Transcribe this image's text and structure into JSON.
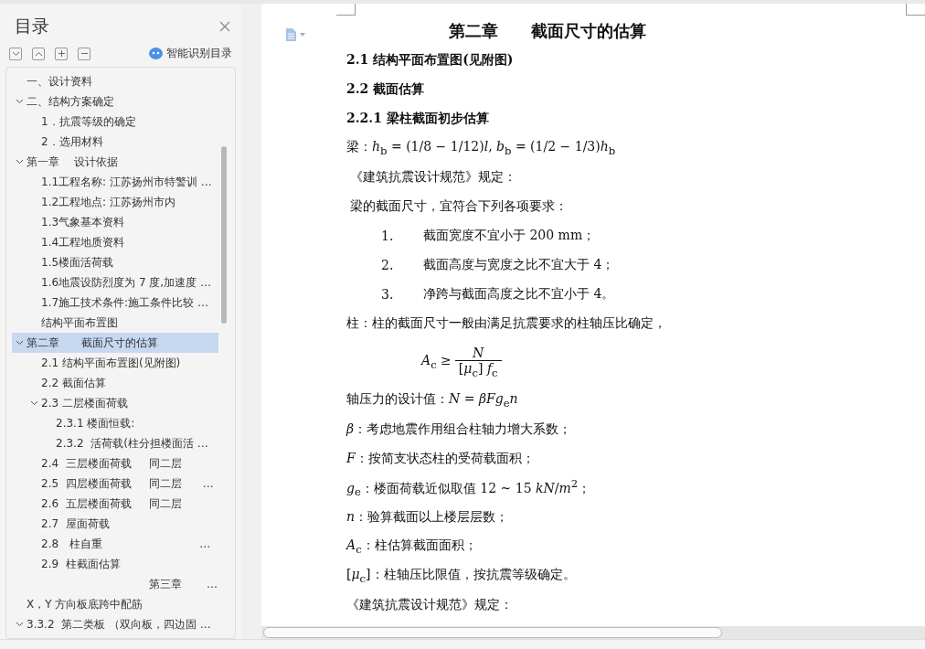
{
  "sidebar": {
    "title": "目录",
    "smart_toc_label": "智能识别目录",
    "outline": [
      {
        "text": "一、设计资料",
        "selected": false
      },
      {
        "text": "二、结构方案确定",
        "selected": false,
        "expanded": true,
        "children": [
          {
            "text": "1．抗震等级的确定",
            "selected": false
          },
          {
            "text": "2．选用材料",
            "selected": false
          }
        ]
      },
      {
        "text": "第一章　 设计依据",
        "selected": false,
        "expanded": true,
        "children": [
          {
            "text": "1.1工程名称: 江苏扬州市特警训 …",
            "selected": false
          },
          {
            "text": "1.2工程地点: 江苏扬州市内",
            "selected": false
          },
          {
            "text": "1.3气象基本资料",
            "selected": false
          },
          {
            "text": "1.4工程地质资料",
            "selected": false
          },
          {
            "text": "1.5楼面活荷载",
            "selected": false
          },
          {
            "text": "1.6地震设防烈度为 7 度,加速度 …",
            "selected": false
          },
          {
            "text": "1.7施工技术条件:施工条件比较 …",
            "selected": false
          },
          {
            "text": "结构平面布置图",
            "selected": false
          }
        ]
      },
      {
        "text": "第二章　　截面尺寸的估算",
        "selected": true,
        "expanded": true,
        "children": [
          {
            "text": "2.1 结构平面布置图(见附图)",
            "selected": false
          },
          {
            "text": "2.2 截面估算",
            "selected": false
          },
          {
            "text": "2.3 二层楼面荷载",
            "selected": false,
            "expanded": true,
            "children": [
              {
                "text": "2.3.1 楼面恒载:",
                "selected": false
              },
              {
                "text": "2.3.2  活荷载(柱分担楼面活 …",
                "selected": false
              }
            ]
          },
          {
            "text": "2.4  三层楼面荷载     同二层",
            "selected": false
          },
          {
            "text": "2.5  四层楼面荷载     同二层      …",
            "selected": false
          },
          {
            "text": "2.6  五层楼面荷载     同二层",
            "selected": false
          },
          {
            "text": "2.7  屋面荷载",
            "selected": false
          },
          {
            "text": "2.8   柱自重                            …",
            "selected": false
          },
          {
            "text": "2.9  柱截面估算",
            "selected": false
          },
          {
            "text": "                               第三章       …",
            "selected": false
          }
        ]
      },
      {
        "text": "X，Y 方向板底跨中配筋",
        "selected": false
      },
      {
        "text": "3.3.2  第二类板 （双向板，四边固 …",
        "selected": false,
        "expanded": true
      }
    ]
  },
  "document": {
    "blocks": [
      {
        "kind": "title",
        "text": "第二章　　截面尺寸的估算"
      },
      {
        "kind": "heading",
        "text": "2.1 结构平面布置图(见附图)"
      },
      {
        "kind": "heading",
        "text": "2.2 截面估算"
      },
      {
        "kind": "heading",
        "text": "2.2.1 梁柱截面初步估算"
      },
      {
        "kind": "para",
        "text": "梁：*h*$_{b}$ = (1/8 − 1/12)*l*, *b*$_{b}$ = (1/2 − 1/3)*h*$_{b}$"
      },
      {
        "kind": "para",
        "text": " 《建筑抗震设计规范》规定："
      },
      {
        "kind": "para",
        "text": " 梁的截面尺寸，宜符合下列各项要求："
      },
      {
        "kind": "list",
        "number": "1.",
        "text": "截面宽度不宜小于 200 mm；"
      },
      {
        "kind": "list",
        "number": "2.",
        "text": "截面高度与宽度之比不宜大于 4；"
      },
      {
        "kind": "list",
        "number": "3.",
        "text": "净跨与截面高度之比不宜小于 4。"
      },
      {
        "kind": "para",
        "text": "柱：柱的截面尺寸一般由满足抗震要求的柱轴压比确定，"
      },
      {
        "kind": "fraction",
        "lhs": "*A*$_{c}$ ≥",
        "numerator": "*N*",
        "denominator": "[*μ*$_{c}$] *f*$_{c}$"
      },
      {
        "kind": "para",
        "text": "轴压力的设计值：*N* = *βFg*$_{e}$*n*"
      },
      {
        "kind": "para",
        "text": "*β*：考虑地震作用组合柱轴力增大系数；"
      },
      {
        "kind": "para",
        "text": "*F*：按简支状态柱的受荷载面积；"
      },
      {
        "kind": "para",
        "text": "*g*$_{e}$：楼面荷载近似取值 12 ~ 15 *kN*/*m*$^{2}$；"
      },
      {
        "kind": "para",
        "text": "*n*：验算截面以上楼层层数；"
      },
      {
        "kind": "para",
        "text": "*A*$_{c}$：柱估算截面面积；"
      },
      {
        "kind": "para",
        "text": "[*μ*$_{c}$]：柱轴压比限值，按抗震等级确定。"
      },
      {
        "kind": "para",
        "text": "《建筑抗震设计规范》规定："
      }
    ]
  }
}
